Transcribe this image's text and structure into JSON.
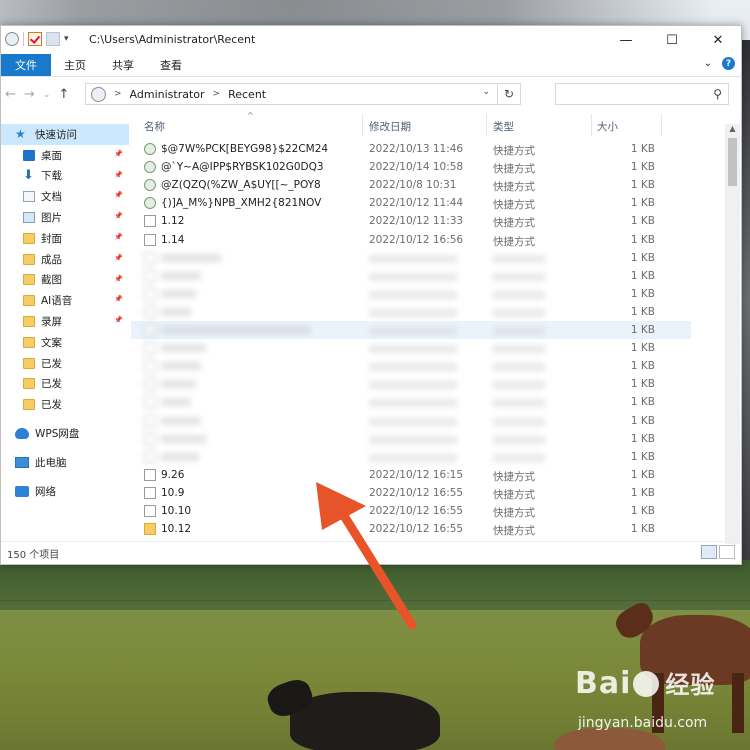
{
  "window": {
    "title_path": "C:\\Users\\Administrator\\Recent",
    "controls": [
      "—",
      "☐",
      "✕"
    ]
  },
  "ribbon": {
    "tabs": [
      "文件",
      "主页",
      "共享",
      "查看"
    ]
  },
  "address": {
    "crumbs": [
      "Administrator",
      "Recent"
    ],
    "search_placeholder": ""
  },
  "sidebar": {
    "quick_access": "快速访问",
    "items": [
      {
        "label": "桌面",
        "icon": "desktop-icon",
        "pinned": true
      },
      {
        "label": "下载",
        "icon": "download-icon",
        "pinned": true
      },
      {
        "label": "文档",
        "icon": "document-icon",
        "pinned": true
      },
      {
        "label": "图片",
        "icon": "picture-icon",
        "pinned": true
      },
      {
        "label": "封面",
        "icon": "folder-icon",
        "pinned": true
      },
      {
        "label": "成品",
        "icon": "folder-icon",
        "pinned": true
      },
      {
        "label": "截图",
        "icon": "folder-icon",
        "pinned": true
      },
      {
        "label": "AI语音",
        "icon": "folder-icon",
        "pinned": true
      },
      {
        "label": "录屏",
        "icon": "folder-icon",
        "pinned": true
      },
      {
        "label": "文案",
        "icon": "folder-icon",
        "pinned": false
      },
      {
        "label": "已发",
        "icon": "folder-icon",
        "pinned": false
      },
      {
        "label": "已发",
        "icon": "folder-icon",
        "pinned": false
      },
      {
        "label": "已发",
        "icon": "folder-icon",
        "pinned": false
      }
    ],
    "wps": "WPS网盘",
    "this_pc": "此电脑",
    "network": "网络"
  },
  "columns": [
    "名称",
    "修改日期",
    "类型",
    "大小"
  ],
  "files": [
    {
      "name": "$@7W%PCK[BEYG98}$22CM24",
      "date": "2022/10/13 11:46",
      "type": "快捷方式",
      "size": "1 KB",
      "icon": "network-shortcut-icon"
    },
    {
      "name": "@`Y~A@IPP$RYBSK102G0DQ3",
      "date": "2022/10/14 10:58",
      "type": "快捷方式",
      "size": "1 KB",
      "icon": "network-shortcut-icon"
    },
    {
      "name": "@Z(QZQ(%ZW_A$UY[[~_POY8",
      "date": "2022/10/8 10:31",
      "type": "快捷方式",
      "size": "1 KB",
      "icon": "network-shortcut-icon"
    },
    {
      "name": "{)]A_M%}NPB_XMH2{821NOV",
      "date": "2022/10/12 11:44",
      "type": "快捷方式",
      "size": "1 KB",
      "icon": "network-shortcut-icon"
    },
    {
      "name": "1.12",
      "date": "2022/10/12 11:33",
      "type": "快捷方式",
      "size": "1 KB",
      "icon": "file-shortcut-icon"
    },
    {
      "name": "1.14",
      "date": "2022/10/12 16:56",
      "type": "快捷方式",
      "size": "1 KB",
      "icon": "file-shortcut-icon"
    }
  ],
  "blurred_sizes": [
    "1 KB",
    "1 KB",
    "1 KB",
    "1 KB",
    "1 KB",
    "1 KB",
    "1 KB",
    "1 KB",
    "1 KB",
    "1 KB",
    "1 KB",
    "1 KB"
  ],
  "files_bottom": [
    {
      "name": "9.26",
      "date": "2022/10/12 16:15",
      "type": "快捷方式",
      "size": "1 KB",
      "icon": "file-shortcut-icon"
    },
    {
      "name": "10.9",
      "date": "2022/10/12 16:55",
      "type": "快捷方式",
      "size": "1 KB",
      "icon": "file-shortcut-icon"
    },
    {
      "name": "10.10",
      "date": "2022/10/12 16:55",
      "type": "快捷方式",
      "size": "1 KB",
      "icon": "file-shortcut-icon"
    },
    {
      "name": "10.12",
      "date": "2022/10/12 16:55",
      "type": "快捷方式",
      "size": "1 KB",
      "icon": "folder-shortcut-icon"
    }
  ],
  "status": {
    "item_count": "150 个项目"
  },
  "watermark": {
    "logo_text": "Bai",
    "logo_text_2": "经验",
    "url": "jingyan.baidu.com"
  },
  "annotation": {
    "arrow_color": "#e8542a"
  }
}
